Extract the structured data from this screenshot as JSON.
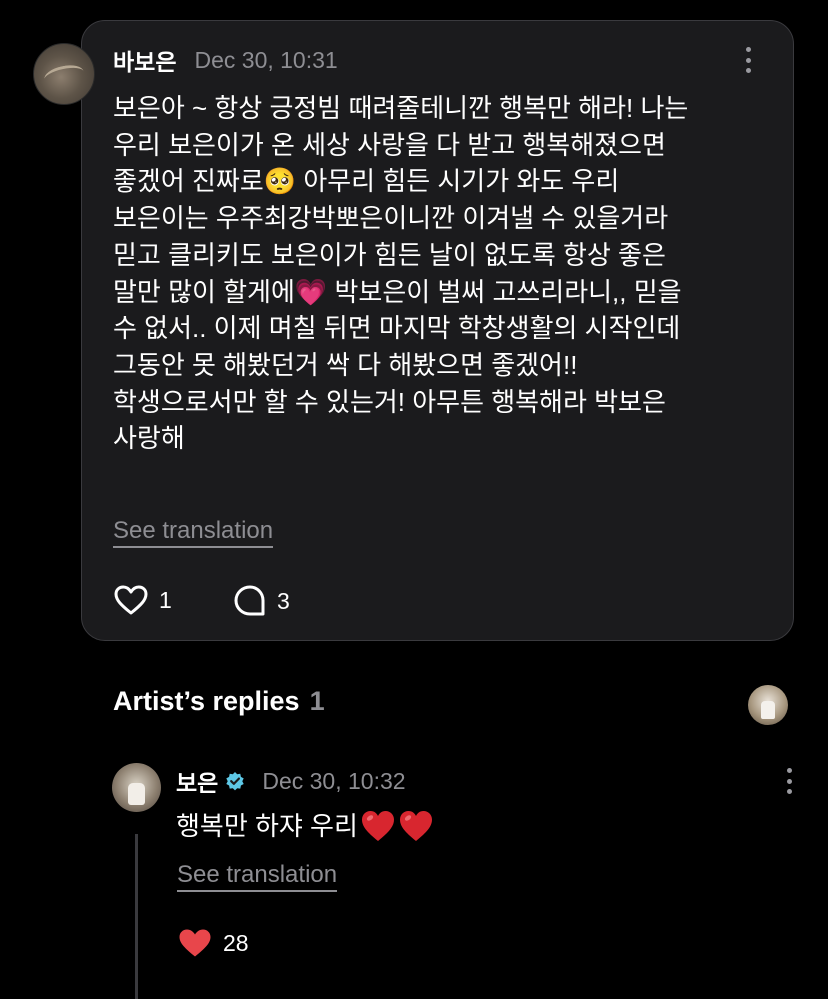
{
  "post": {
    "author": "바보은",
    "timestamp": "Dec 30, 10:31",
    "body": "보은아 ~ 항상 긍정빔 때려줄테니깐 행복만 해라! 나는\n우리 보은이가 온 세상 사랑을 다 받고 행복해졌으면\n좋겠어 진짜로🥺 아무리 힘든 시기가 와도 우리\n보은이는 우주최강박뽀은이니깐 이겨낼 수 있을거라\n믿고 클리키도 보은이가 힘든 날이 없도록 항상 좋은\n말만 많이 할게에💗 박보은이 벌써 고쓰리라니,, 믿을\n수 없서.. 이제 며칠 뒤면 마지막 학창생활의 시작인데\n그동안 못 해봤던거 싹 다 해봤으면 좋겠어!!\n학생으로서만 할 수 있는거! 아무튼 행복해라 박보은\n사랑해",
    "see_translation": "See translation",
    "like_count": "1",
    "comment_count": "3",
    "like_icon": "heart-outline-icon",
    "comment_icon": "comment-bubble-icon"
  },
  "replies": {
    "title": "Artist’s replies",
    "count": "1"
  },
  "reply": {
    "author": "보은",
    "verified_icon": "verified-badge-icon",
    "timestamp": "Dec 30, 10:32",
    "body": "행복만 하쟈 우리",
    "emoji": "❤️❤️",
    "see_translation": "See translation",
    "like_count": "28",
    "like_icon": "heart-filled-icon"
  },
  "colors": {
    "background": "#000000",
    "card": "#1b1b1d",
    "card_border": "#3a3a3e",
    "muted_text": "#8e8e93",
    "verified": "#5ec8e6",
    "heart_red": "#e8464b"
  }
}
